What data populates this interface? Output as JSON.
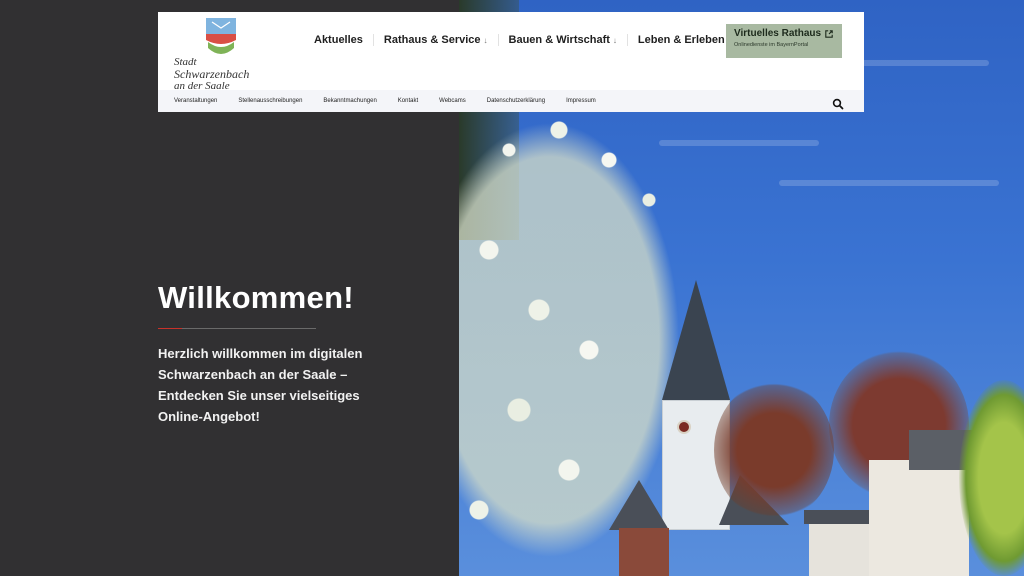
{
  "header": {
    "logo": {
      "line1": "Stadt",
      "line2": "Schwarzenbach",
      "line3": "an der Saale"
    },
    "main_nav": [
      {
        "label": "Aktuelles",
        "has_dropdown": false
      },
      {
        "label": "Rathaus & Service",
        "has_dropdown": true
      },
      {
        "label": "Bauen & Wirtschaft",
        "has_dropdown": true
      },
      {
        "label": "Leben & Erleben",
        "has_dropdown": true
      }
    ],
    "cta": {
      "title": "Virtuelles Rathaus",
      "subtitle": "Onlinedienste im BayernPortal"
    },
    "sub_nav": [
      "Veranstaltungen",
      "Stellenausschreibungen",
      "Bekanntmachungen",
      "Kontakt",
      "Webcams",
      "Datenschutzerklärung",
      "Impressum"
    ],
    "dropdown_caret": "↓"
  },
  "hero": {
    "title": "Willkommen!",
    "text": "Herzlich willkommen im digitalen Schwarzenbach an der Saale – Entdecken Sie unser vielseitiges Online-Angebot!"
  },
  "colors": {
    "dark_panel": "#313032",
    "cta_bg": "#a8b9a1",
    "accent_red": "#c8322a",
    "sky": "#3a73d2"
  },
  "icons": {
    "search": "search-icon",
    "external_link": "external-link-icon",
    "logo": "city-coat-of-arms-icon"
  }
}
